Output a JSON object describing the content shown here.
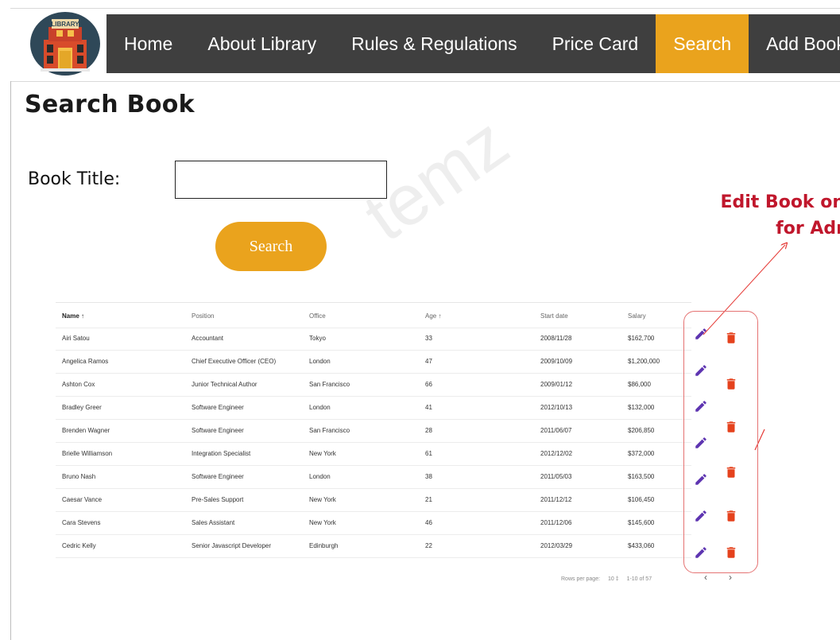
{
  "brand": {
    "logo_text": "LIBRARY"
  },
  "nav": {
    "items": [
      {
        "label": "Home"
      },
      {
        "label": "About Library"
      },
      {
        "label": "Rules & Regulations"
      },
      {
        "label": "Price Card"
      },
      {
        "label": "Search",
        "active": true
      },
      {
        "label": "Add Book"
      }
    ]
  },
  "page": {
    "title": "Search Book",
    "book_title_label": "Book Title:",
    "book_title_value": "",
    "search_label": "Search",
    "watermark": "temz"
  },
  "annotation": {
    "line1": "Edit Book on",
    "line2": "for Adr"
  },
  "table": {
    "columns": [
      "Name ↑",
      "Position",
      "Office",
      "Age ↑",
      "Start date",
      "Salary"
    ],
    "rows": [
      [
        "Airi Satou",
        "Accountant",
        "Tokyo",
        "33",
        "2008/11/28",
        "$162,700"
      ],
      [
        "Angelica Ramos",
        "Chief Executive Officer (CEO)",
        "London",
        "47",
        "2009/10/09",
        "$1,200,000"
      ],
      [
        "Ashton Cox",
        "Junior Technical Author",
        "San Francisco",
        "66",
        "2009/01/12",
        "$86,000"
      ],
      [
        "Bradley Greer",
        "Software Engineer",
        "London",
        "41",
        "2012/10/13",
        "$132,000"
      ],
      [
        "Brenden Wagner",
        "Software Engineer",
        "San Francisco",
        "28",
        "2011/06/07",
        "$206,850"
      ],
      [
        "Brielle Williamson",
        "Integration Specialist",
        "New York",
        "61",
        "2012/12/02",
        "$372,000"
      ],
      [
        "Bruno Nash",
        "Software Engineer",
        "London",
        "38",
        "2011/05/03",
        "$163,500"
      ],
      [
        "Caesar Vance",
        "Pre-Sales Support",
        "New York",
        "21",
        "2011/12/12",
        "$106,450"
      ],
      [
        "Cara Stevens",
        "Sales Assistant",
        "New York",
        "46",
        "2011/12/06",
        "$145,600"
      ],
      [
        "Cedric Kelly",
        "Senior Javascript Developer",
        "Edinburgh",
        "22",
        "2012/03/29",
        "$433,060"
      ]
    ],
    "footer": {
      "rows_per_page_label": "Rows per page:",
      "rows_per_page_value": "10 ‡",
      "range": "1-10 of 57",
      "prev": "‹",
      "next": "›"
    }
  },
  "colors": {
    "nav_bg": "#3f3f3f",
    "accent": "#eaa31d",
    "annotation": "#c0172c",
    "edit": "#5e35b1",
    "delete": "#e5421d"
  },
  "icons": {
    "edit": "pencil-icon",
    "delete": "trash-icon"
  }
}
